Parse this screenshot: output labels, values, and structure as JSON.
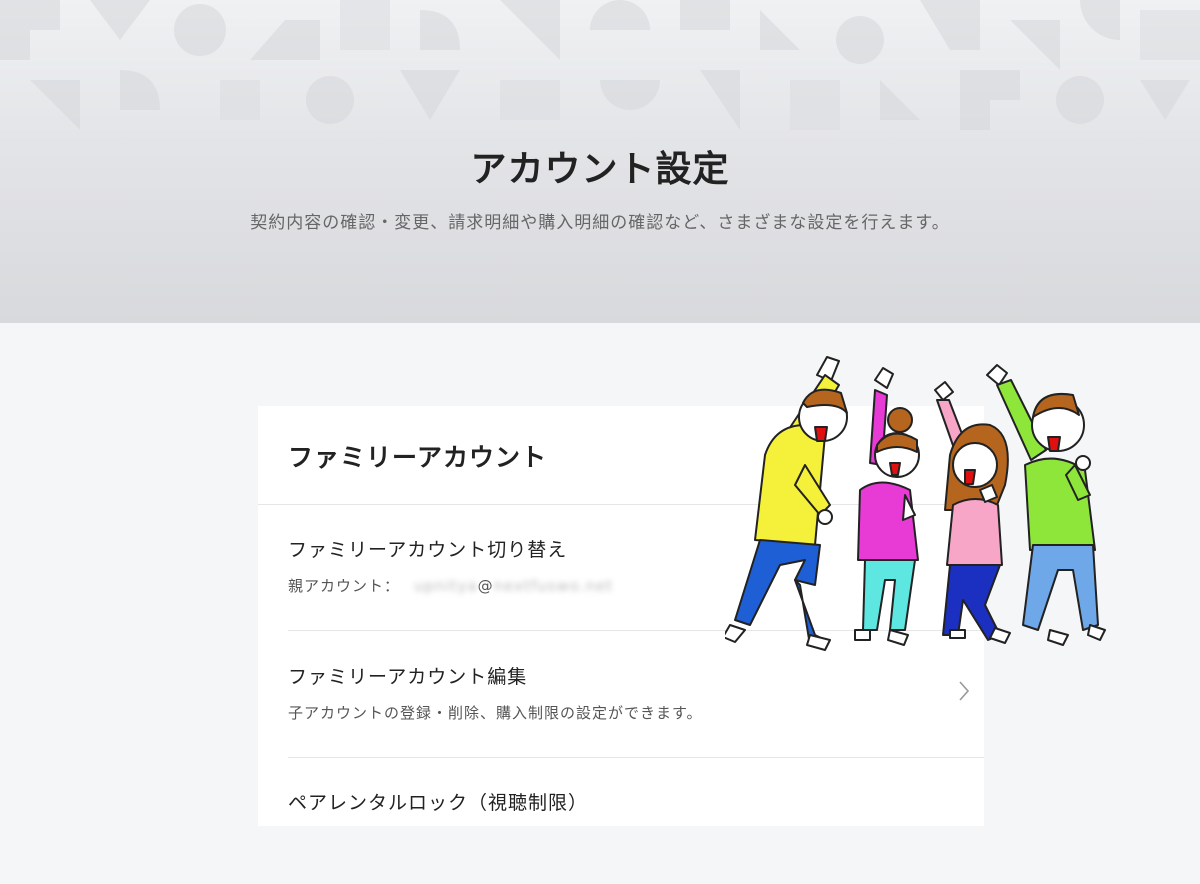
{
  "header": {
    "title": "アカウント設定",
    "subtitle": "契約内容の確認・変更、請求明細や購入明細の確認など、さまざまな設定を行えます。"
  },
  "section": {
    "title": "ファミリーアカウント",
    "items": [
      {
        "title": "ファミリーアカウント切り替え",
        "desc_label": "親アカウント：",
        "desc_email_local": "upnitya",
        "desc_at": "@",
        "desc_email_domain": "nextfuswo.net"
      },
      {
        "title": "ファミリーアカウント編集",
        "desc": "子アカウントの登録・削除、購入制限の設定ができます。"
      },
      {
        "title": "ペアレンタルロック（視聴制限）"
      }
    ]
  },
  "colors": {
    "hero_bg": "#dedfe2",
    "page_bg": "#f5f6f8",
    "card_bg": "#ffffff"
  },
  "icons": [
    "chevron-right-icon"
  ]
}
